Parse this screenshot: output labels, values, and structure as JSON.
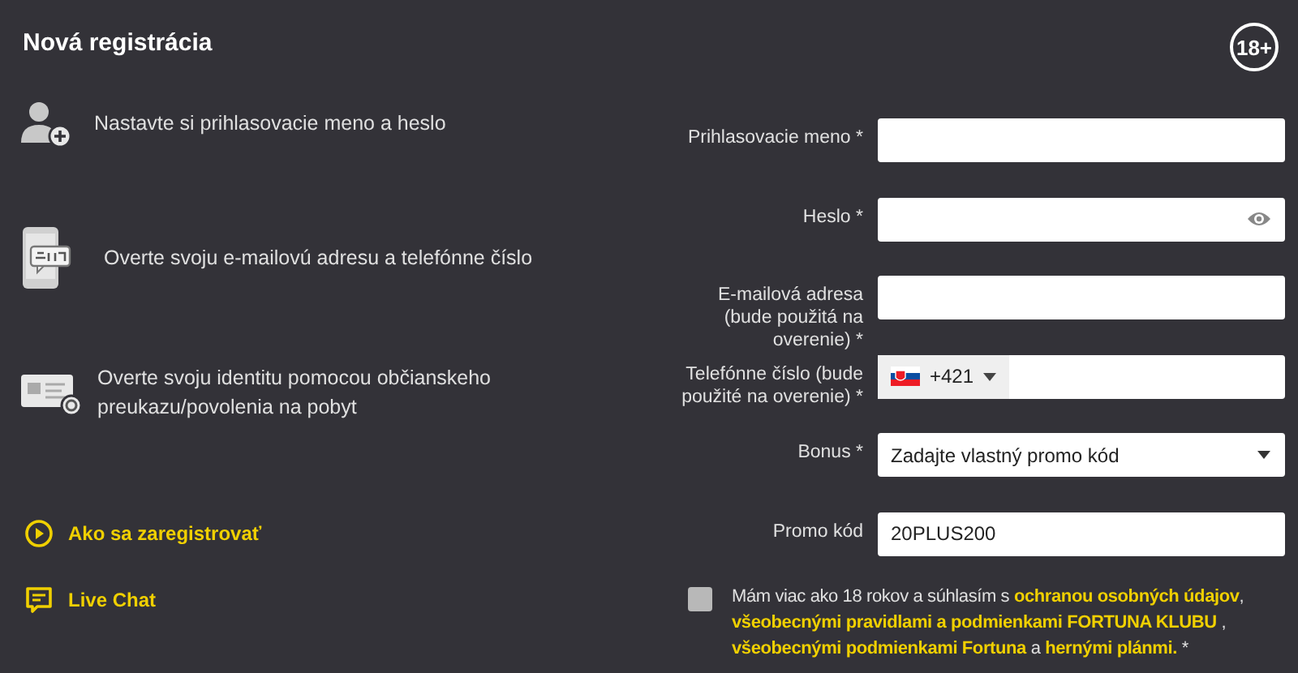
{
  "title": "Nová registrácia",
  "age_badge": "18+",
  "steps": [
    {
      "kind": "account",
      "text": "Nastavte si prihlasovacie meno a heslo"
    },
    {
      "kind": "sms",
      "text": "Overte svoju e-mailovú adresu a telefónne číslo"
    },
    {
      "kind": "id",
      "text": "Overte svoju identitu pomocou občianskeho preukazu/povolenia na pobyt"
    }
  ],
  "links": [
    {
      "kind": "video",
      "label": "Ako sa zaregistrovať"
    },
    {
      "kind": "chat",
      "label": "Live Chat"
    }
  ],
  "form": [
    {
      "kind": "text",
      "label": "Prihlasovacie meno *"
    },
    {
      "kind": "password",
      "label": "Heslo *"
    },
    {
      "kind": "text",
      "label": "E-mailová adresa (bude použitá na overenie) *"
    },
    {
      "kind": "phone",
      "label": "Telefónne číslo (bude použité na overenie) *",
      "prefix": "+421"
    },
    {
      "kind": "select",
      "label": "Bonus *",
      "value": "Zadajte vlastný promo kód"
    },
    {
      "kind": "text",
      "label": "Promo kód",
      "value": "20PLUS200"
    }
  ],
  "consent": {
    "checked": false,
    "parts": [
      {
        "kind": "text",
        "text": "Mám viac ako 18 rokov a súhlasím s "
      },
      {
        "kind": "link",
        "text": "ochranou osobných údajov"
      },
      {
        "kind": "text",
        "text": ", "
      },
      {
        "kind": "link",
        "text": "všeobecnými pravidlami a podmienkami FORTUNA KLUBU"
      },
      {
        "kind": "text",
        "text": " , "
      },
      {
        "kind": "link",
        "text": "všeobecnými podmienkami Fortuna"
      },
      {
        "kind": "text",
        "text": " a "
      },
      {
        "kind": "link",
        "text": "hernými plánmi."
      },
      {
        "kind": "text",
        "text": " *"
      }
    ]
  }
}
